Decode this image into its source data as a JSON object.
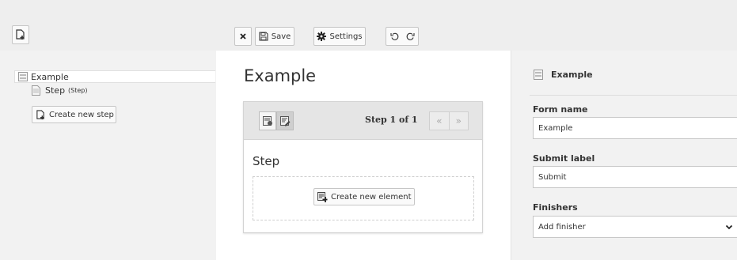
{
  "toolbar": {
    "new_page_icon": "new-page-icon",
    "close_icon": "close-icon",
    "save_label": "Save",
    "settings_label": "Settings",
    "undo_icon": "undo-icon",
    "redo_icon": "redo-icon"
  },
  "tree": {
    "root_label": "Example",
    "step_label": "Step",
    "step_type": "(Step)",
    "create_step_label": "Create new step"
  },
  "stage": {
    "title": "Example",
    "pager_text": "Step 1 of 1",
    "prev": "«",
    "next": "»",
    "step_title": "Step",
    "create_element_label": "Create new element"
  },
  "inspector": {
    "header": "Example",
    "form_name_label": "Form name",
    "form_name_value": "Example",
    "submit_label_label": "Submit label",
    "submit_label_value": "Submit",
    "finishers_label": "Finishers",
    "finishers_selected": "Add finisher"
  }
}
